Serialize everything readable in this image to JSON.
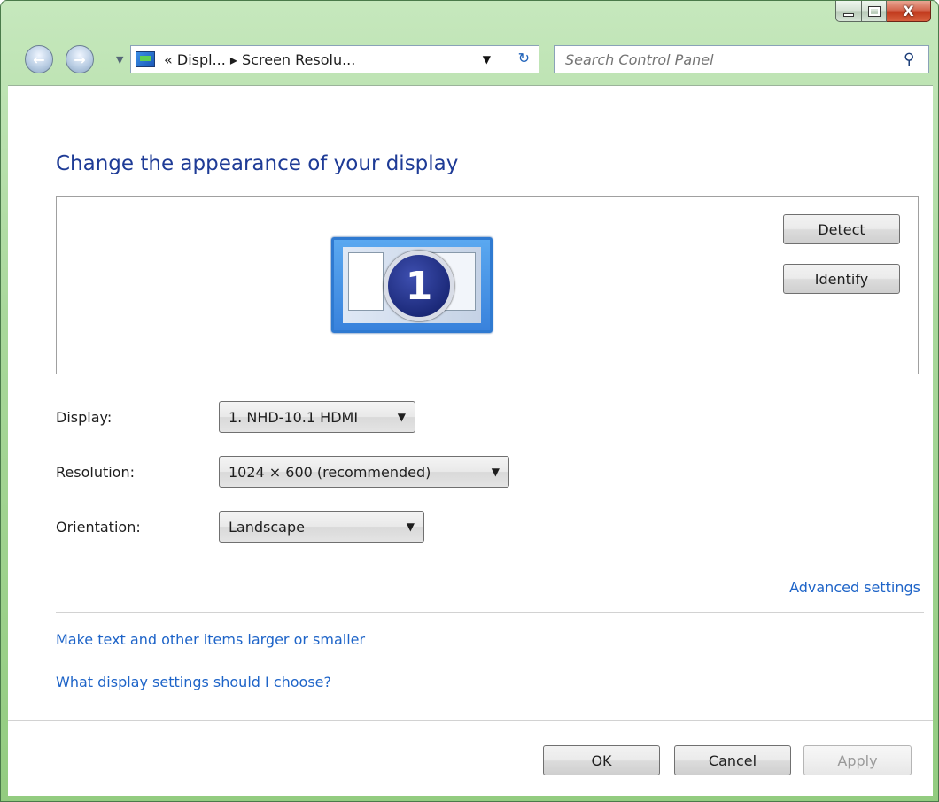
{
  "window": {
    "controls": {
      "minimize_icon": "minimize-icon",
      "maximize_icon": "maximize-icon",
      "close_symbol": "X"
    }
  },
  "nav": {
    "back_arrow": "←",
    "forward_arrow": "→",
    "breadcrumb": "« Displ... ▸ Screen Resolu...",
    "dropdown_arrow": "▼",
    "refresh_symbol": "↻",
    "search_placeholder": "Search Control Panel"
  },
  "page": {
    "title": "Change the appearance of your display"
  },
  "display_area": {
    "monitor_number": "1",
    "detect_label": "Detect",
    "identify_label": "Identify"
  },
  "settings": {
    "display": {
      "label": "Display:",
      "value": "1. NHD-10.1 HDMI"
    },
    "resolution": {
      "label": "Resolution:",
      "value": "1024 × 600 (recommended)"
    },
    "orientation": {
      "label": "Orientation:",
      "value": "Landscape"
    },
    "dropdown_arrow": "▼"
  },
  "links": {
    "advanced": "Advanced settings",
    "text_size": "Make text and other items larger or smaller",
    "which_settings": "What display settings should I choose?"
  },
  "footer": {
    "ok": "OK",
    "cancel": "Cancel",
    "apply": "Apply"
  },
  "colors": {
    "title_blue": "#1e3b96",
    "link_blue": "#1e64c8",
    "chrome_green": "#a9d89b"
  }
}
